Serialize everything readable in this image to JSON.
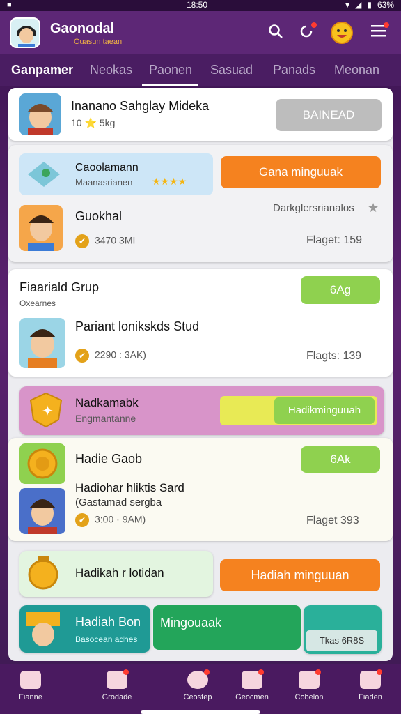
{
  "status": {
    "time": "18:50",
    "battery": "63%"
  },
  "header": {
    "brand": "Gaonodal",
    "brand_sub": "Ouasun taean"
  },
  "tabs": [
    "Ganpamer",
    "Neokas",
    "Paonen",
    "Sasuad",
    "Panads",
    "Meonan"
  ],
  "cards": {
    "c1": {
      "title": "Inanano Sahglay Mideka",
      "sub": "10 ⭐  5kg",
      "button": "BAINEAD"
    },
    "c2a": {
      "title": "Caoolamann",
      "sub": "Maanasrianen",
      "stars": "★★★★",
      "button": "Gana minguuak"
    },
    "c2b": {
      "title": "Guokhal",
      "sub": "3470  3MI",
      "right_top": "Darkglersrianalos",
      "right_bottom": "Flaget: 159"
    },
    "group": {
      "title": "Fiaariald Grup",
      "sub": "Oxearnes",
      "button": "6Ag"
    },
    "group_item": {
      "title": "Pariant lonikskds Stud",
      "sub": "2290 : 3AK)",
      "right": "Flagts: 139"
    },
    "c4": {
      "title": "Nadkamabk",
      "sub": "Engmantanne",
      "button": "Hadikminguuah"
    },
    "c5": {
      "title": "Hadie Gaob",
      "button": "6Ak",
      "item_title": "Hadiohar hliktis Sard",
      "item_sub1": "(Gastamad sergba",
      "item_sub2": "3:00 · 9AM)",
      "right": "Flaget 393"
    },
    "c6": {
      "title": "Hadikah r lotidan",
      "button": "Hadiah minguuan"
    },
    "c7": {
      "title": "Hadiah Bon",
      "sub": "Basocean adhes",
      "button": "Mingouaak",
      "tag": "Tkas 6R8S"
    }
  },
  "nav": [
    "Fianne",
    "Grodade",
    "Ceostep",
    "Geocmen",
    "Cobelon",
    "Fiaden"
  ],
  "colors": {
    "orange": "#f5821f",
    "green": "#8fd14f",
    "gray": "#bdbdbd",
    "purple": "#5d2776"
  }
}
